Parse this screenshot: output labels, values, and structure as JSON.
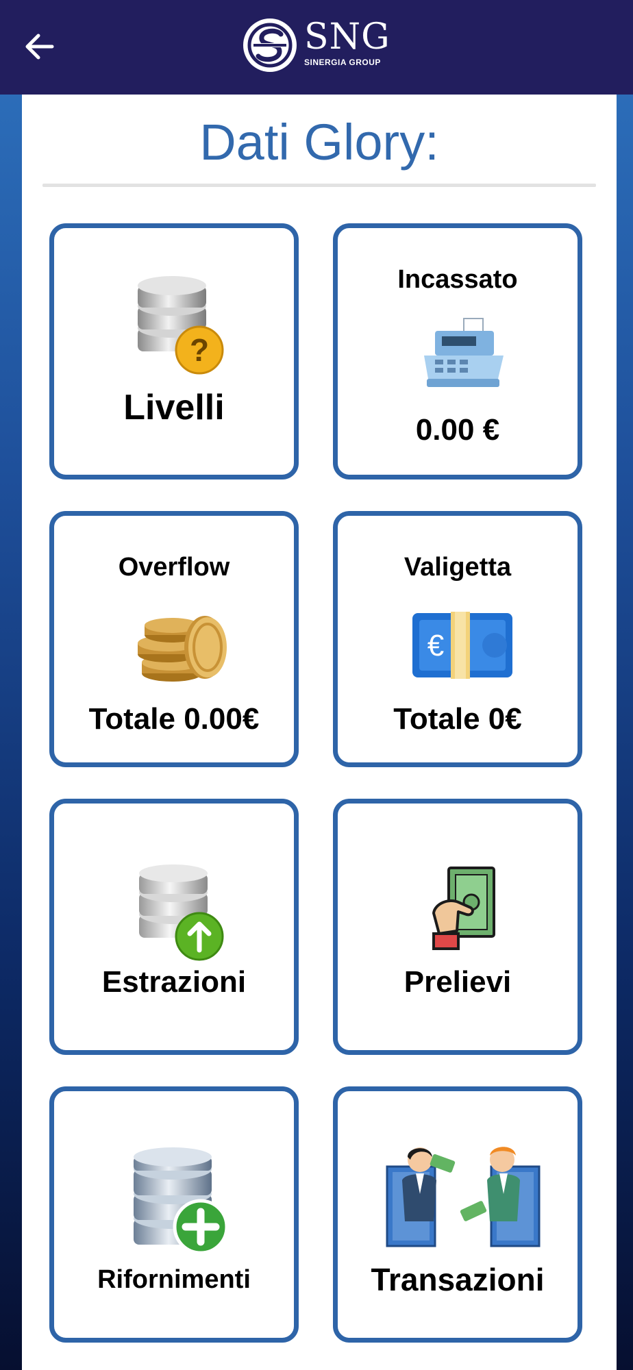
{
  "header": {
    "back_icon": "arrow-left-icon",
    "logo_text": "SNG",
    "logo_subtitle": "SINERGIA GROUP"
  },
  "page": {
    "title": "Dati Glory:"
  },
  "cards": {
    "livelli": {
      "label": "Livelli",
      "icon": "database-question-icon"
    },
    "incassato": {
      "label": "Incassato",
      "value": "0.00 €",
      "icon": "cash-register-icon"
    },
    "overflow": {
      "label": "Overflow",
      "value": "Totale 0.00€",
      "icon": "coins-stack-icon"
    },
    "valigetta": {
      "label": "Valigetta",
      "value": "Totale 0€",
      "icon": "euro-banknote-icon"
    },
    "estrazioni": {
      "label": "Estrazioni",
      "icon": "database-upload-icon"
    },
    "prelievi": {
      "label": "Prelievi",
      "icon": "hand-money-icon"
    },
    "rifornimenti": {
      "label": "Rifornimenti",
      "icon": "database-add-icon"
    },
    "transazioni": {
      "label": "Transazioni",
      "icon": "money-exchange-icon"
    }
  },
  "colors": {
    "appbar": "#221e5e",
    "accent": "#3269ad",
    "card_border": "#2e64a8"
  }
}
